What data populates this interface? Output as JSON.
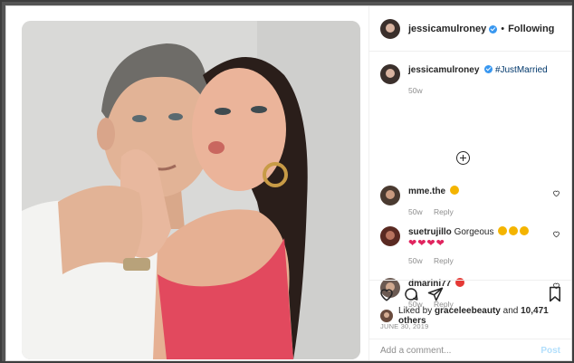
{
  "post": {
    "username": "jessicamulroney",
    "follow_label": "Following",
    "separator": "•",
    "caption_username": "jessicamulroney",
    "caption_text": "#JustMarried",
    "caption_age": "50w"
  },
  "comments": [
    {
      "username": "mme.the",
      "text": "",
      "age": "50w",
      "reply": "Reply"
    },
    {
      "username": "suetrujillo",
      "text": "Gorgeous",
      "hearts": "❤❤❤❤",
      "age": "50w",
      "reply": "Reply"
    },
    {
      "username": "dmarini77",
      "text": "",
      "age": "50w",
      "reply": "Reply"
    }
  ],
  "actions": {
    "liked_by_prefix": "Liked by",
    "liked_by_user": "graceleebeauty",
    "and_text": "and",
    "others_count": "10,471 others",
    "date": "JUNE 30, 2019"
  },
  "comment_box": {
    "placeholder": "Add a comment...",
    "post_label": "Post"
  },
  "colors": {
    "verified": "#3897f0",
    "post_button": "#b2dffc",
    "hashtag": "#00376b",
    "heart": "#e0245e"
  }
}
